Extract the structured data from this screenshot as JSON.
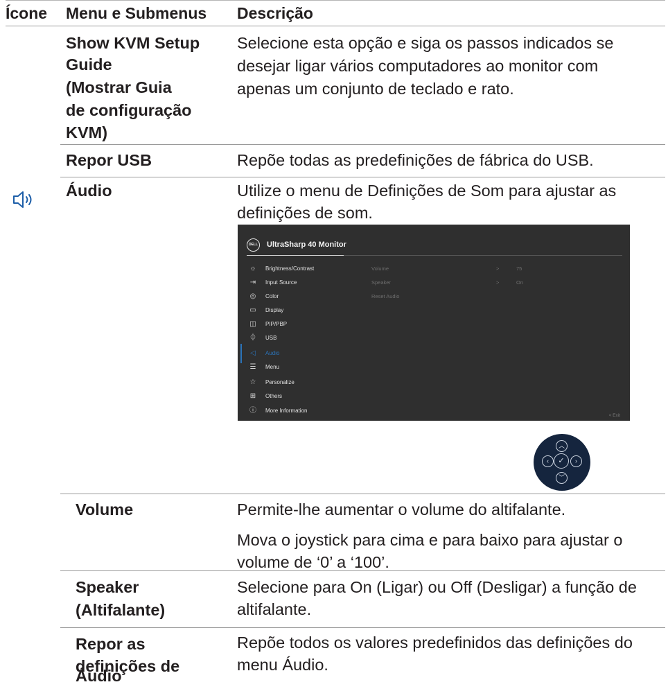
{
  "header": {
    "col_icon": "Ícone",
    "col_menu": "Menu e Submenus",
    "col_desc": "Descrição"
  },
  "rows": {
    "kvm": {
      "menu_lines": [
        "Show KVM Setup",
        "Guide",
        "(Mostrar Guia",
        "de configuração",
        "KVM)"
      ],
      "desc_lines": [
        "Selecione esta opção e siga os passos indicados se",
        "desejar ligar vários computadores ao monitor com",
        "apenas um conjunto de teclado e rato."
      ]
    },
    "repor_usb": {
      "menu": "Repor USB",
      "desc": "Repõe todas as predefinições de fábrica do USB."
    },
    "audio": {
      "icon": "speaker-icon",
      "menu": "Áudio",
      "desc_lines": [
        "Utilize o menu de Definições de Som para ajustar as",
        "definições de som."
      ]
    },
    "volume": {
      "menu": "Volume",
      "desc_1": "Permite-lhe aumentar o volume do altifalante.",
      "desc_2_lines": [
        "Mova o joystick para cima e para baixo para ajustar o",
        "volume de ‘0’ a ‘100’."
      ]
    },
    "speaker": {
      "menu_lines": [
        "Speaker",
        "(Altifalante)"
      ],
      "desc_lines": [
        "Selecione para On (Ligar) ou Off (Desligar) a função de",
        "altifalante."
      ]
    },
    "repor_audio": {
      "menu_lines": [
        "Repor as",
        "definições de",
        "Áudio"
      ],
      "desc_lines": [
        "Repõe todos os valores predefinidos das definições do",
        "menu Áudio."
      ]
    }
  },
  "osd": {
    "logo": "DELL",
    "title": "UltraSharp 40 Monitor",
    "menu_items": [
      {
        "label": "Brightness/Contrast",
        "icon": "brightness-icon"
      },
      {
        "label": "Input Source",
        "icon": "input-source-icon"
      },
      {
        "label": "Color",
        "icon": "color-icon"
      },
      {
        "label": "Display",
        "icon": "display-icon"
      },
      {
        "label": "PIP/PBP",
        "icon": "pip-pbp-icon"
      },
      {
        "label": "USB",
        "icon": "usb-icon"
      },
      {
        "label": "Audio",
        "icon": "audio-icon"
      },
      {
        "label": "Menu",
        "icon": "menu-icon"
      },
      {
        "label": "Personalize",
        "icon": "star-icon"
      },
      {
        "label": "Others",
        "icon": "others-icon"
      },
      {
        "label": "More Information",
        "icon": "info-icon"
      }
    ],
    "active_item": "Audio",
    "sub_items": [
      {
        "label": "Volume",
        "arrow": ">",
        "value": "75"
      },
      {
        "label": "Speaker",
        "arrow": ">",
        "value": "On"
      },
      {
        "label": "Reset Audio",
        "arrow": "",
        "value": ""
      }
    ],
    "exit": "<  Exit"
  },
  "colors": {
    "osd_bg": "#2f2f2f",
    "osd_accent": "#2b73b8",
    "joystick_bg": "#15253e"
  }
}
